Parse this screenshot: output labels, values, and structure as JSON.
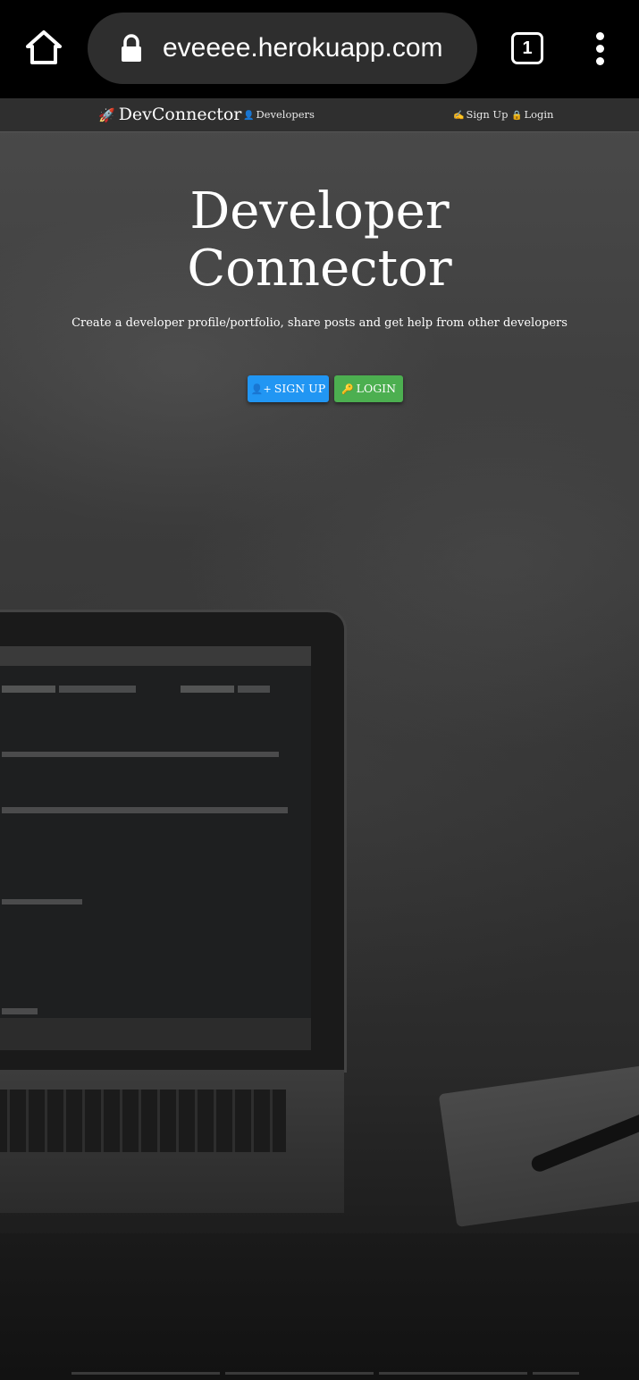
{
  "browser": {
    "url": "eveeee.herokuapp.com",
    "tab_count": "1",
    "icons": {
      "home": "home-icon",
      "lock": "lock-icon",
      "tabs": "tab-switcher-icon",
      "menu": "more-vert-icon"
    }
  },
  "navbar": {
    "brand": "DevConnector",
    "links": {
      "developers": "Developers",
      "signup": "Sign Up",
      "login": "Login"
    }
  },
  "hero": {
    "title_line1": "Developer",
    "title_line2": "Connector",
    "lead": "Create a developer profile/portfolio, share posts and get help from other developers",
    "signup_button": "SIGN UP",
    "login_button": "LOGIN"
  },
  "colors": {
    "signup_button": "#2196f3",
    "login_button": "#4caf50",
    "navbar": "#2f2f2f"
  }
}
